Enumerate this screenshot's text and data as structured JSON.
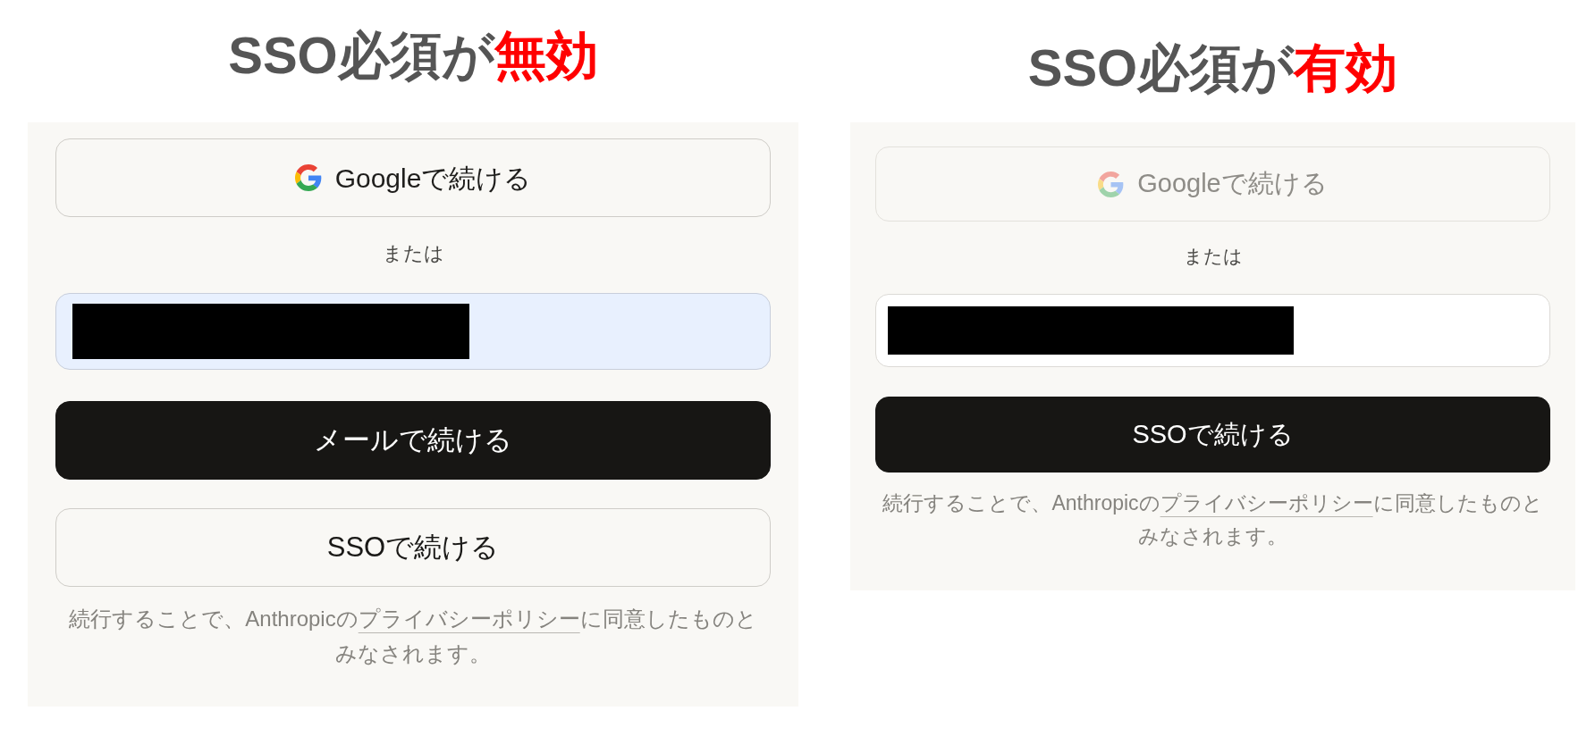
{
  "panels": [
    {
      "title": [
        {
          "text": "SSO必須が",
          "emphasis": false
        },
        {
          "text": "無効",
          "emphasis": true
        }
      ],
      "google_button": {
        "label": "Googleで続ける",
        "disabled": false
      },
      "separator": "または",
      "input_field": {
        "autofilled": true,
        "redacted": true
      },
      "buttons": [
        {
          "kind": "primary",
          "label": "メールで続ける"
        },
        {
          "kind": "secondary",
          "label": "SSOで続ける"
        }
      ],
      "consent": {
        "before": "続行することで、Anthropicの",
        "link": "プライバシーポリシー",
        "after": "に同意したものとみなされます。"
      }
    },
    {
      "title": [
        {
          "text": "SSO必須が",
          "emphasis": false
        },
        {
          "text": "有効",
          "emphasis": true
        }
      ],
      "google_button": {
        "label": "Googleで続ける",
        "disabled": true
      },
      "separator": "または",
      "input_field": {
        "autofilled": false,
        "redacted": true
      },
      "buttons": [
        {
          "kind": "primary",
          "label": "SSOで続ける"
        }
      ],
      "consent": {
        "before": "続行することで、Anthropicの",
        "link": "プライバシーポリシー",
        "after": "に同意したものとみなされます。"
      }
    }
  ]
}
